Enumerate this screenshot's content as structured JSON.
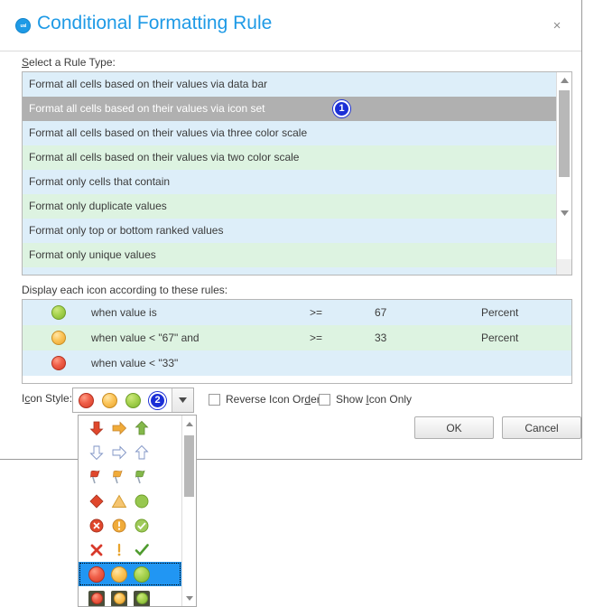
{
  "dialog": {
    "title": "Conditional Formatting Rule",
    "title_icon": "app-logo-icon",
    "close_label": "×"
  },
  "rule_type": {
    "label": "Select a Rule Type:",
    "items": [
      {
        "label": "Format all cells based on their values via data bar",
        "selected": false
      },
      {
        "label": "Format all cells based on their values via icon set",
        "selected": true
      },
      {
        "label": "Format all cells based on their values via three color scale",
        "selected": false
      },
      {
        "label": "Format all cells based on their values via two color scale",
        "selected": false
      },
      {
        "label": "Format only cells that contain",
        "selected": false
      },
      {
        "label": "Format only duplicate values",
        "selected": false
      },
      {
        "label": "Format only top or bottom ranked values",
        "selected": false
      },
      {
        "label": "Format only unique values",
        "selected": false
      }
    ],
    "badge": "1"
  },
  "icon_rules": {
    "label": "Display each icon according to these rules:",
    "rows": [
      {
        "icon": "green-ball-icon",
        "condition": "when value is",
        "operator": ">=",
        "value": "67",
        "type": "Percent"
      },
      {
        "icon": "amber-ball-icon",
        "condition": "when value < \"67\" and",
        "operator": ">=",
        "value": "33",
        "type": "Percent"
      },
      {
        "icon": "red-ball-icon",
        "condition": "when value < \"33\"",
        "operator": "",
        "value": "",
        "type": ""
      }
    ]
  },
  "icon_style": {
    "label": "Icon Style:",
    "selected_set": [
      "red-ball-icon",
      "amber-ball-icon",
      "green-ball-icon"
    ],
    "badge": "2",
    "dropdown_arrow": "▼",
    "options": [
      {
        "name": "arrows-3-colored",
        "icons": [
          "down-arrow-red",
          "right-arrow-amber",
          "up-arrow-green"
        ],
        "selected": false
      },
      {
        "name": "arrows-3-gray",
        "icons": [
          "down-arrow-gray",
          "right-arrow-gray",
          "up-arrow-gray"
        ],
        "selected": false
      },
      {
        "name": "flags-3",
        "icons": [
          "flag-red",
          "flag-amber",
          "flag-green"
        ],
        "selected": false
      },
      {
        "name": "shapes-3",
        "icons": [
          "diamond-red",
          "triangle-amber",
          "circle-green"
        ],
        "selected": false
      },
      {
        "name": "symbols-3-circled",
        "icons": [
          "cross-circle-red",
          "exclamation-circle-amber",
          "check-circle-green"
        ],
        "selected": false
      },
      {
        "name": "symbols-3-uncircled",
        "icons": [
          "cross-red",
          "exclamation-amber",
          "check-green"
        ],
        "selected": false
      },
      {
        "name": "traffic-lights-3-unrimmed",
        "icons": [
          "red-ball-icon",
          "amber-ball-icon",
          "green-ball-icon"
        ],
        "selected": true
      },
      {
        "name": "traffic-lights-3-rimmed",
        "icons": [
          "red-ball-rimmed",
          "amber-ball-rimmed",
          "green-ball-rimmed"
        ],
        "selected": false
      }
    ]
  },
  "options": {
    "reverse_icon_order": {
      "label": "Reverse Icon Order",
      "checked": false
    },
    "show_icon_only": {
      "label": "Show Icon Only",
      "checked": false
    }
  },
  "buttons": {
    "ok": "OK",
    "cancel": "Cancel"
  },
  "colors": {
    "accent": "#1e9ae6",
    "row_blue": "#ddeef9",
    "row_green": "#ddf3e1",
    "row_selected": "#b0b0b0",
    "badge": "#1b2fd6",
    "dropdown_selected": "#2196f3"
  }
}
